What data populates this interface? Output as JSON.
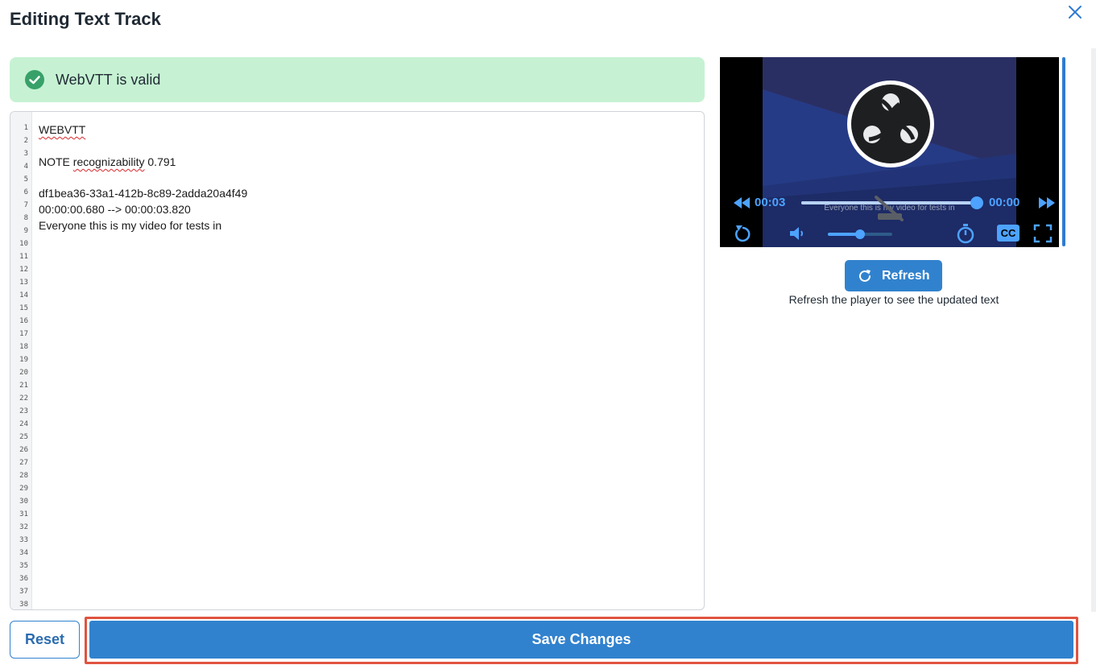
{
  "dialog": {
    "title": "Editing Text Track"
  },
  "validation": {
    "message": "WebVTT is valid",
    "status_color": "#c6f2d3"
  },
  "editor": {
    "line_numbers": [
      "1",
      "2",
      "3",
      "4",
      "5",
      "6",
      "7",
      "8",
      "9",
      "10",
      "11",
      "12",
      "13",
      "14",
      "15",
      "16",
      "17",
      "18",
      "19",
      "20",
      "21",
      "22",
      "23",
      "24",
      "25",
      "26",
      "27",
      "28",
      "29",
      "30",
      "31",
      "32",
      "33",
      "34",
      "35",
      "36",
      "37",
      "38"
    ],
    "lines": {
      "l1": "WEBVTT",
      "l4_prefix": "NOTE ",
      "l4_word": "recognizability",
      "l4_suffix": " 0.791",
      "l6": "df1bea36-33a1-412b-8c89-2adda20a4f49",
      "l7": "00:00:00.680 --> 00:00:03.820",
      "l8": "Everyone this is my video for tests in"
    }
  },
  "player": {
    "current_time": "00:03",
    "remaining_time": "00:00",
    "caption": "Everyone this is my video for tests in",
    "progress_fraction": 0.99,
    "volume_fraction": 0.5,
    "icons": [
      "rewind-icon",
      "fast-forward-icon",
      "replay-icon",
      "volume-icon",
      "timer-icon",
      "closed-captions-icon",
      "fullscreen-icon"
    ],
    "cc_label": "CC"
  },
  "refresh": {
    "label": "Refresh",
    "note": "Refresh the player to see the updated text"
  },
  "footer": {
    "reset_label": "Reset",
    "save_label": "Save Changes"
  },
  "colors": {
    "accent": "#3182ce",
    "highlight_outline": "#e0533f"
  }
}
